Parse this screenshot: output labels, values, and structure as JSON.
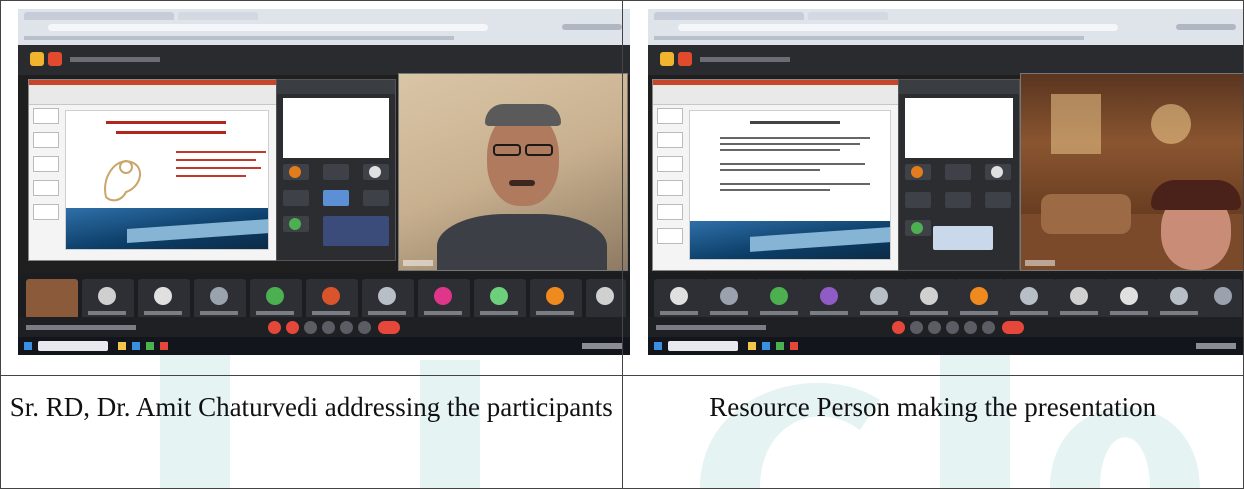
{
  "captions": {
    "left": "Sr. RD, Dr. Amit Chaturvedi addressing the participants",
    "right": "Resource Person making the presentation"
  },
  "photos": {
    "left": {
      "description_icon": "video-conference-screenshot-icon"
    },
    "right": {
      "description_icon": "video-conference-screenshot-icon"
    }
  },
  "colors": {
    "watermark": "#e8f4f4",
    "slide_band": "#0b3d66",
    "end_call": "#e5483a",
    "app_accent": "#f1b42f"
  }
}
